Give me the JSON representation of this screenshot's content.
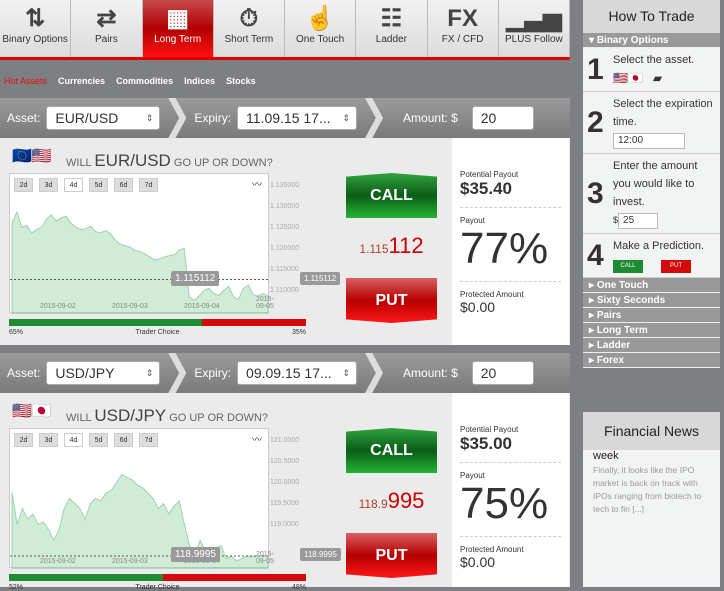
{
  "nav": [
    {
      "label": "Binary Options",
      "icon": "arrows-up-down-icon",
      "glyph": "⇅"
    },
    {
      "label": "Pairs",
      "icon": "arrows-left-right-icon",
      "glyph": "⇄"
    },
    {
      "label": "Long Term",
      "icon": "calendar-icon",
      "glyph": "▦",
      "active": true
    },
    {
      "label": "Short Term",
      "icon": "stopwatch-icon",
      "glyph": "⏱"
    },
    {
      "label": "One Touch",
      "icon": "hand-pointer-icon",
      "glyph": "☝"
    },
    {
      "label": "Ladder",
      "icon": "ladder-icon",
      "glyph": "☷"
    },
    {
      "label": "FX / CFD",
      "icon": "fx-icon",
      "glyph": "FX"
    },
    {
      "label": "PLUS Follow",
      "icon": "signal-bars-icon",
      "glyph": "▁▃▅"
    }
  ],
  "subnav": [
    "Hot Assets",
    "Currencies",
    "Commodities",
    "Indices",
    "Stocks"
  ],
  "labels": {
    "asset": "Asset:",
    "expiry": "Expiry:",
    "amount": "Amount: $",
    "will": "WILL",
    "updown": "GO UP OR DOWN?",
    "call": "CALL",
    "put": "PUT",
    "potential": "Potential Payout",
    "payout": "Payout",
    "protected": "Protected Amount",
    "trader_choice": "Trader Choice"
  },
  "ranges": [
    "2d",
    "3d",
    "4d",
    "5d",
    "6d",
    "7d"
  ],
  "panels": [
    {
      "asset": "EUR/USD",
      "expiry": "11.09.15 17...",
      "amount": "20",
      "price_small": "1.115",
      "price_big": "112",
      "current": "1.115112",
      "potential": "$35.40",
      "payout": "77%",
      "protected": "$0.00",
      "call_pct": 65,
      "call_label": "65%",
      "put_label": "35%",
      "yticks": [
        "1.135000",
        "1.130000",
        "1.125000",
        "1.120000",
        "1.115000",
        "1.110000"
      ],
      "xticks": [
        "2015-09-02",
        "2015-09-03",
        "2015-09-04",
        "2015-09-05"
      ],
      "series": [
        1.1285,
        1.1312,
        1.1275,
        1.128,
        1.1262,
        1.127,
        1.1275,
        1.1295,
        1.1305,
        1.129,
        1.1298,
        1.1302,
        1.1285,
        1.1275,
        1.127,
        1.1272,
        1.1278,
        1.1265,
        1.1262,
        1.1268,
        1.126,
        1.1245,
        1.1235,
        1.1232,
        1.1228,
        1.122,
        1.1218,
        1.1212,
        1.1205,
        1.1198,
        1.12,
        1.1205,
        1.1208,
        1.121,
        1.1222,
        1.1225,
        1.111,
        1.1102,
        1.1112,
        1.1125,
        1.113,
        1.1118,
        1.1113,
        1.1125,
        1.1135,
        1.111,
        1.1103,
        1.113,
        1.1138,
        1.1115,
        1.1112,
        1.1118,
        1.1112
      ]
    },
    {
      "asset": "USD/JPY",
      "expiry": "09.09.15 17...",
      "amount": "20",
      "price_small": "118.9",
      "price_big": "995",
      "current": "118.9995",
      "potential": "$35.00",
      "payout": "75%",
      "protected": "$0.00",
      "call_pct": 52,
      "call_label": "52%",
      "put_label": "48%",
      "yticks": [
        "121.0000",
        "120.5000",
        "120.0000",
        "119.5000",
        "119.0000"
      ],
      "xticks": [
        "2015-09-02",
        "2015-09-03",
        "2015-09-04",
        "2015-09-05"
      ],
      "series": [
        120.2,
        119.6,
        119.9,
        119.7,
        119.8,
        119.6,
        119.65,
        119.5,
        119.3,
        119.5,
        119.9,
        120.1,
        120.0,
        119.9,
        119.7,
        120.0,
        120.1,
        120.05,
        120.2,
        120.25,
        120.4,
        120.55,
        120.5,
        120.45,
        120.35,
        120.3,
        120.2,
        120.1,
        119.9,
        120.0,
        119.8,
        119.95,
        120.05,
        119.6,
        119.2,
        119.0,
        119.3,
        119.1,
        119.0,
        119.15,
        119.2,
        118.95,
        119.0,
        118.9,
        118.95,
        119.0,
        118.98,
        119.0,
        119.0,
        119.0
      ]
    }
  ],
  "sidebar": {
    "title": "How To Trade",
    "open": "Binary Options",
    "steps": [
      {
        "n": "1",
        "text": "Select the asset."
      },
      {
        "n": "2",
        "text": "Select the expiration time.",
        "value": "12:00"
      },
      {
        "n": "3",
        "text": "Enter the amount you would like to invest.",
        "currency": "$",
        "value": "25"
      },
      {
        "n": "4",
        "text": "Make a Prediction.",
        "call": "CALL",
        "put": "PUT"
      }
    ],
    "sections": [
      "One Touch",
      "Sixty Seconds",
      "Pairs",
      "Long Term",
      "Ladder",
      "Forex"
    ]
  },
  "news": {
    "title": "Financial News",
    "headline": "week",
    "snippet": "Finally, it looks like the IPO market is back on track with IPOs ranging from biotech to tech to fin [...]"
  },
  "colors": {
    "accent": "#d00000",
    "call": "#1e8a32",
    "put": "#d20a0a"
  }
}
